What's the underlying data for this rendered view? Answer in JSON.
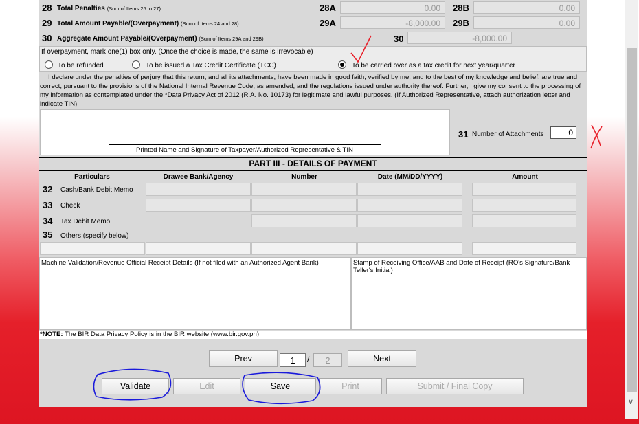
{
  "colors": {
    "form_bg": "#d9d9d9",
    "annotation_red": "#e8202a",
    "annotation_blue": "#1a1adb"
  },
  "items": {
    "28": {
      "num": "28",
      "label": "Total Penalties",
      "note": "(Sum of Items 25 to 27)",
      "a_code": "28A",
      "a_value": "0.00",
      "b_code": "28B",
      "b_value": "0.00"
    },
    "29": {
      "num": "29",
      "label": "Total Amount Payable/(Overpayment)",
      "note": "(Sum of Items 24 and 28)",
      "a_code": "29A",
      "a_value": "-8,000.00",
      "b_code": "29B",
      "b_value": "0.00"
    },
    "30": {
      "num": "30",
      "label": "Aggregate Amount Payable/(Overpayment)",
      "note": "(Sum of Items 29A and 29B)",
      "code": "30",
      "value": "-8,000.00"
    }
  },
  "overpayment": {
    "instruction": "If overpayment, mark one(1) box only. (Once the choice is made, the same is irrevocable)",
    "options": [
      "To be refunded",
      "To be issued a Tax Credit Certificate (TCC)",
      "To be carried over as a tax credit for next year/quarter"
    ],
    "selected_index": 2
  },
  "declaration": "I declare under the penalties of perjury that this return, and all its attachments, have been made in good faith, verified by me, and to the best of my knowledge and belief, are true and correct, pursuant to the provisions of the National Internal Revenue Code, as amended, and the regulations issued under authority thereof. Further, I give my consent to the processing of my information as contemplated under the *Data Privacy Act of 2012 (R.A. No. 10173) for legitimate and lawful purposes. (If Authorized Representative, attach authorization letter and indicate TIN)",
  "signature_label": "Printed Name and Signature of Taxpayer/Authorized Representative & TIN",
  "attachments": {
    "num": "31",
    "label": "Number of Attachments",
    "value": "0"
  },
  "part3": {
    "title": "PART III - DETAILS OF PAYMENT",
    "headers": [
      "Particulars",
      "Drawee Bank/Agency",
      "Number",
      "Date (MM/DD/YYYY)",
      "Amount"
    ],
    "rows": [
      {
        "num": "32",
        "label": "Cash/Bank Debit Memo"
      },
      {
        "num": "33",
        "label": "Check"
      },
      {
        "num": "34",
        "label": "Tax Debit Memo"
      },
      {
        "num": "35",
        "label": "Others (specify below)"
      }
    ]
  },
  "machine_validation": "Machine Validation/Revenue Official Receipt Details (If not filed with an Authorized Agent Bank)",
  "stamp": "Stamp of Receiving Office/AAB and Date of Receipt (RO's Signature/Bank Teller's Initial)",
  "note": {
    "bold": "*NOTE:",
    "text": " The BIR Data Privacy Policy is in the BIR website (www.bir.gov.ph)"
  },
  "pager": {
    "prev": "Prev",
    "next": "Next",
    "current": "1",
    "separator": "/",
    "total": "2"
  },
  "actions": {
    "validate": "Validate",
    "edit": "Edit",
    "save": "Save",
    "print": "Print",
    "submit": "Submit / Final Copy"
  },
  "scrollbar_arrow": "∨"
}
